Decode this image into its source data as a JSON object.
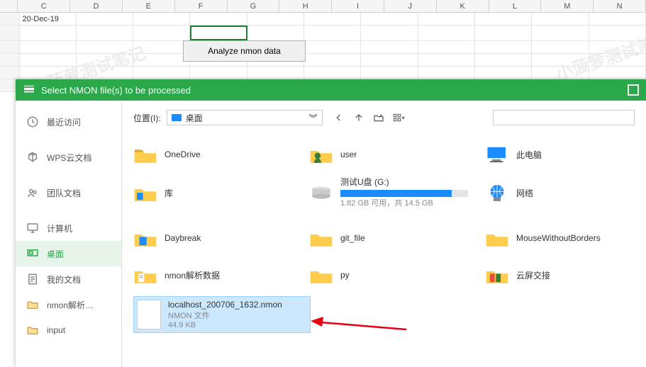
{
  "spreadsheet": {
    "cols": [
      "",
      "C",
      "D",
      "E",
      "F",
      "G",
      "H",
      "I",
      "J",
      "K",
      "L",
      "M",
      "N"
    ],
    "date_cell": "20-Dec-19",
    "analyze_btn": "Analyze nmon data"
  },
  "dialog": {
    "title": "Select NMON file(s) to be processed"
  },
  "sidebar": {
    "items": [
      {
        "label": "最近访问",
        "icon": "clock"
      },
      {
        "label": "WPS云文档",
        "icon": "cloud-cube"
      },
      {
        "label": "团队文档",
        "icon": "team"
      },
      {
        "label": "计算机",
        "icon": "monitor"
      },
      {
        "label": "桌面",
        "icon": "desktop",
        "selected": true
      },
      {
        "label": "我的文档",
        "icon": "doc"
      },
      {
        "label": "nmon解析…",
        "icon": "folder"
      },
      {
        "label": "input",
        "icon": "folder"
      }
    ]
  },
  "location": {
    "label": "位置(I):",
    "value": "桌面"
  },
  "items": {
    "onedrive": "OneDrive",
    "user": "user",
    "thispc": "此电脑",
    "library": "库",
    "usb_name": "测试U盘 (G:)",
    "usb_info": "1.82 GB 可用，共 14.5 GB",
    "usb_pct": 87,
    "network": "网络",
    "daybreak": "Daybreak",
    "gitfile": "git_file",
    "mwb": "MouseWithoutBorders",
    "nmonparse": "nmon解析数据",
    "py": "py",
    "yunping": "云屏交接",
    "selected": {
      "name": "localhost_200706_1632.nmon",
      "type": "NMON 文件",
      "size": "44.9 KB"
    }
  },
  "watermark": "小菠萝测试笔记"
}
